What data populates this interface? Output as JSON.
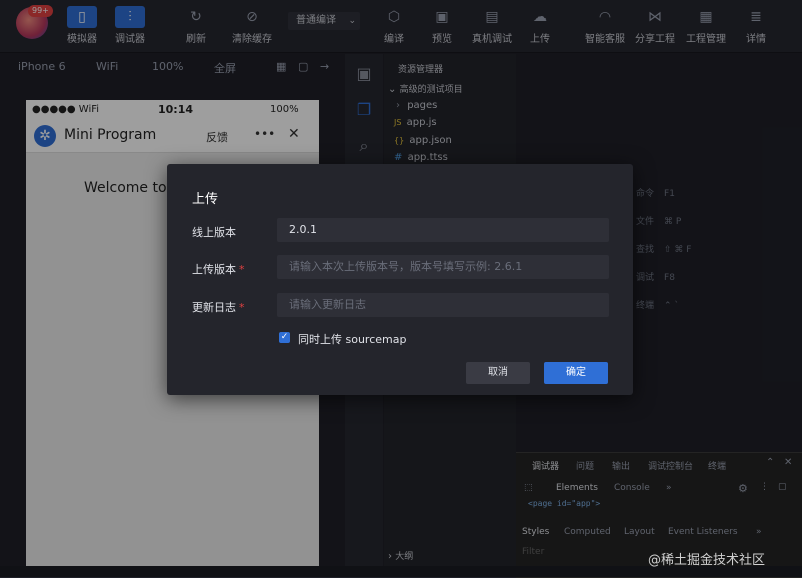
{
  "toolbar": {
    "badge": "99+",
    "buttons": [
      {
        "label": "模拟器",
        "icon": "phone-icon"
      },
      {
        "label": "调试器",
        "icon": "sliders-icon"
      },
      {
        "label": "刷新",
        "icon": "refresh-icon"
      },
      {
        "label": "清除缓存",
        "icon": "clear-cache-icon"
      },
      {
        "label": "编译",
        "icon": "cube-icon"
      },
      {
        "label": "预览",
        "icon": "preview-icon"
      },
      {
        "label": "真机调试",
        "icon": "device-debug-icon"
      },
      {
        "label": "上传",
        "icon": "cloud-upload-icon"
      },
      {
        "label": "智能客服",
        "icon": "headset-icon"
      },
      {
        "label": "分享工程",
        "icon": "share-icon"
      },
      {
        "label": "工程管理",
        "icon": "project-icon"
      },
      {
        "label": "详情",
        "icon": "details-icon"
      }
    ],
    "compile_mode": "普通编译"
  },
  "simbar": {
    "device": "iPhone 6",
    "network": "WiFi",
    "zoom": "100%",
    "fullscreen": "全屏"
  },
  "phone": {
    "status_signal": "●●●●● WiFi",
    "time": "10:14",
    "battery": "100%",
    "title": "Mini Program",
    "feedback": "反馈",
    "welcome": "Welcome to"
  },
  "explorer": {
    "header": "资源管理器",
    "project": "高级的测试项目",
    "files": [
      {
        "name": "pages",
        "icon": "›"
      },
      {
        "name": "app.js",
        "icon": "JS"
      },
      {
        "name": "app.json",
        "icon": "{}"
      },
      {
        "name": "app.ttss",
        "icon": "#"
      }
    ],
    "outline": "大纲"
  },
  "shortcuts": [
    {
      "label": "命令",
      "keys": "F1"
    },
    {
      "label": "文件",
      "keys": "⌘ P"
    },
    {
      "label": "查找",
      "keys": "⇧ ⌘ F"
    },
    {
      "label": "调试",
      "keys": "F8"
    },
    {
      "label": "终端",
      "keys": "⌃ `"
    }
  ],
  "devtools": {
    "tabs": [
      "调试器",
      "问题",
      "输出",
      "调试控制台",
      "终端"
    ],
    "subtabs": [
      "Elements",
      "Console"
    ],
    "code": "<page id=\"app\">",
    "style_tabs": [
      "Styles",
      "Computed",
      "Layout",
      "Event Listeners"
    ],
    "filter": "Filter"
  },
  "dialog": {
    "title": "上传",
    "online_label": "线上版本",
    "online_value": "2.0.1",
    "version_label": "上传版本",
    "version_placeholder": "请输入本次上传版本号，版本号填写示例: 2.6.1",
    "log_label": "更新日志",
    "log_placeholder": "请输入更新日志",
    "sourcemap_label": "同时上传 sourcemap",
    "sourcemap_checked": true,
    "cancel": "取消",
    "confirm": "确定"
  },
  "watermark": "@稀土掘金技术社区"
}
